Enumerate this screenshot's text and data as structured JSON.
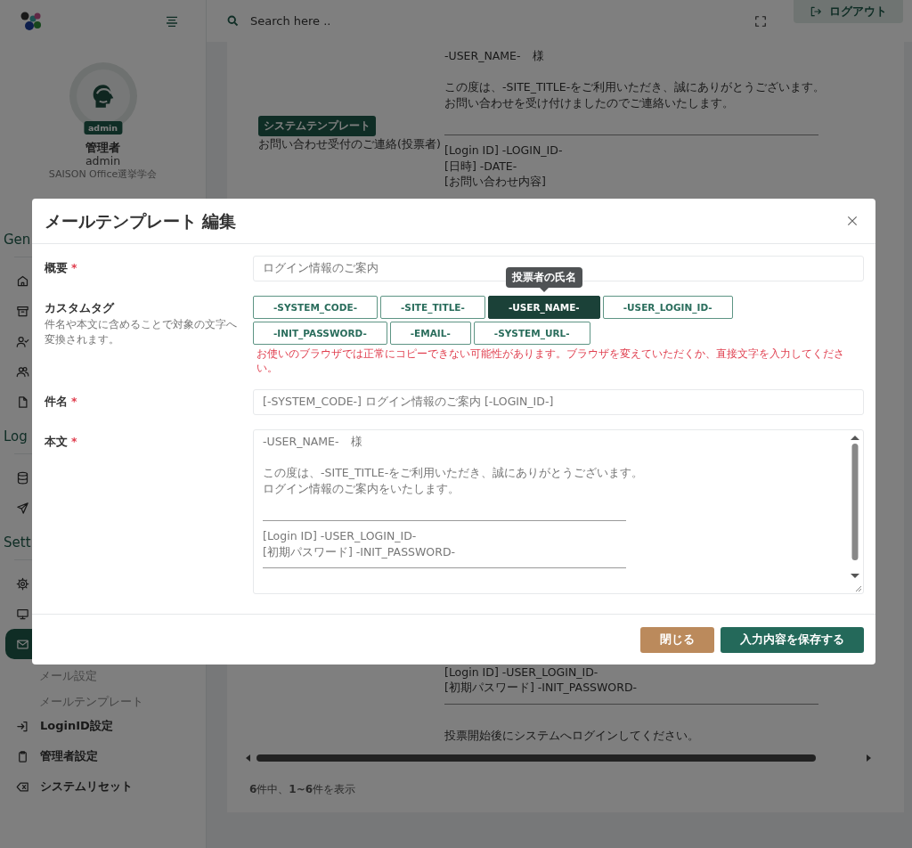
{
  "sidebar": {
    "profile": {
      "badge": "admin",
      "name": "管理者",
      "login_id": "admin",
      "organization": "SAISON Office選挙学会"
    },
    "sections": [
      {
        "title": "Gen",
        "items": [
          {
            "selected": false
          },
          {
            "selected": false
          },
          {
            "selected": false
          },
          {
            "selected": false
          },
          {
            "selected": false
          }
        ]
      },
      {
        "title": "Log",
        "items": [
          {
            "selected": false
          },
          {
            "selected": false
          }
        ]
      },
      {
        "title": "Sett",
        "items": [
          {
            "selected": false
          },
          {
            "selected": false
          },
          {
            "selected": true,
            "children": [
              {
                "label": "メール設定"
              },
              {
                "label": "メールテンプレート"
              }
            ]
          },
          {
            "label": "LoginID設定",
            "selected": false
          },
          {
            "label": "管理者設定",
            "selected": false
          },
          {
            "label": "システムリセット",
            "selected": false
          }
        ]
      }
    ]
  },
  "header": {
    "search": {
      "placeholder": "Search here .."
    },
    "logout_button": "ログアウト"
  },
  "table": {
    "rows": [
      {
        "badge": "システムテンプレート",
        "name": "お問い合わせ受付のご連絡(投票者)",
        "body_top": [
          {
            "kind": "text",
            "text": "-USER_NAME-　様"
          },
          {
            "kind": "blank"
          },
          {
            "kind": "text",
            "text": "この度は、-SITE_TITLE-をご利用いただき、誠にありがとうございます。"
          },
          {
            "kind": "text",
            "text": "お問い合わせを受け付けましたのでご連絡いたします。"
          },
          {
            "kind": "blank"
          },
          {
            "kind": "rule"
          },
          {
            "kind": "text",
            "text": "[Login ID] -LOGIN_ID-"
          },
          {
            "kind": "text",
            "text": "[日時] -DATE-"
          },
          {
            "kind": "text",
            "text": "[お問い合わせ内容]"
          }
        ],
        "body_bottom": [
          {
            "kind": "text",
            "text": "[Login ID] -USER_LOGIN_ID-"
          },
          {
            "kind": "text",
            "text": "[初期パスワード] -INIT_PASSWORD-"
          },
          {
            "kind": "rule"
          },
          {
            "kind": "blank"
          },
          {
            "kind": "text",
            "text": "投票開始後にシステムへログインしてください。"
          }
        ]
      }
    ],
    "footer": "**6**件中、**1~6**件を表示"
  },
  "modal": {
    "title": "メールテンプレート 編集",
    "fields": [
      {
        "kind": "input",
        "label": "概要",
        "required": true,
        "required_mark": "*",
        "value": "ログイン情報のご案内"
      },
      {
        "kind": "tags",
        "label": "カスタムタグ",
        "description": "件名や本文に含めることで対象の文字へ変換されます。",
        "tags": [
          {
            "label": "-SYSTEM_CODE-",
            "selected": false
          },
          {
            "label": "-SITE_TITLE-",
            "selected": false
          },
          {
            "label": "-USER_NAME-",
            "selected": true,
            "tooltip": "投票者の氏名"
          },
          {
            "label": "-USER_LOGIN_ID-",
            "selected": false
          },
          {
            "label": "-INIT_PASSWORD-",
            "selected": false
          },
          {
            "label": "-EMAIL-",
            "selected": false
          },
          {
            "label": "-SYSTEM_URL-",
            "selected": false
          }
        ],
        "warning": "お使いのブラウザでは正常にコピーできない可能性があります。ブラウザを変えていただくか、直接文字を入力してください。"
      },
      {
        "kind": "input",
        "label": "件名",
        "required": true,
        "required_mark": "*",
        "value": "[-SYSTEM_CODE-] ログイン情報のご案内 [-LOGIN_ID-]"
      },
      {
        "kind": "textarea",
        "label": "本文",
        "required": true,
        "required_mark": "*",
        "lines": [
          {
            "kind": "text",
            "text": "-USER_NAME-　様"
          },
          {
            "kind": "blank"
          },
          {
            "kind": "text",
            "text": "この度は、-SITE_TITLE-をご利用いただき、誠にありがとうございます。"
          },
          {
            "kind": "text",
            "text": "ログイン情報のご案内をいたします。"
          },
          {
            "kind": "blank"
          },
          {
            "kind": "rule"
          },
          {
            "kind": "text",
            "text": "[Login ID] -USER_LOGIN_ID-"
          },
          {
            "kind": "text",
            "text": "[初期パスワード] -INIT_PASSWORD-"
          },
          {
            "kind": "rule"
          }
        ]
      }
    ],
    "buttons": [
      {
        "kind": "secondary",
        "label": "閉じる"
      },
      {
        "kind": "primary",
        "label": "入力内容を保存する"
      }
    ]
  }
}
